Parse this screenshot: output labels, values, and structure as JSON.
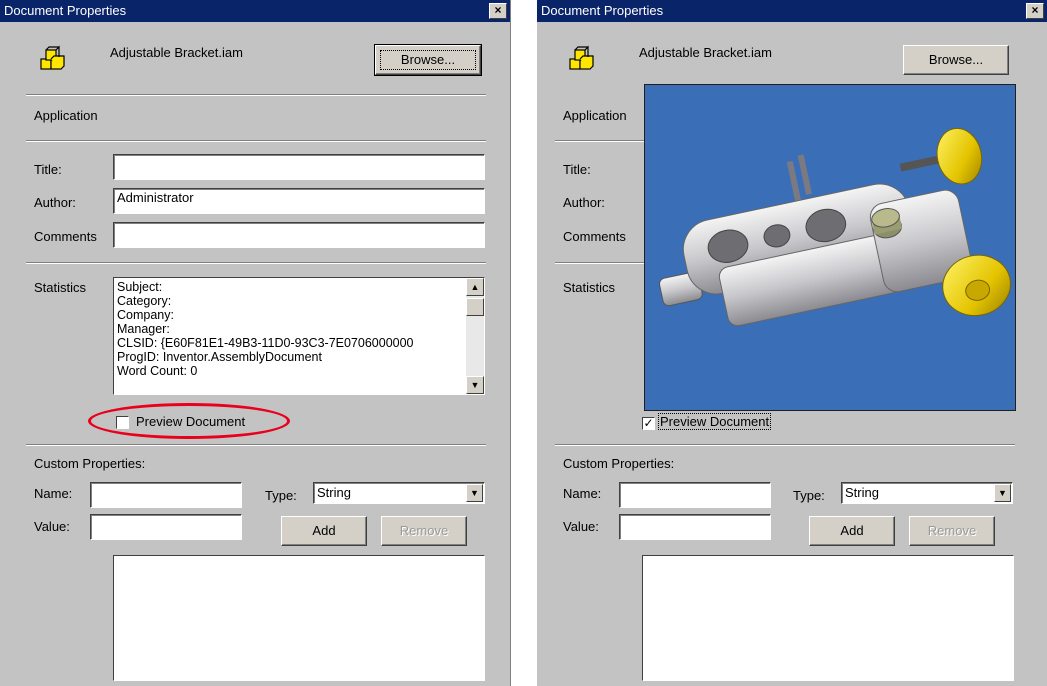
{
  "left_dialog": {
    "title": "Document Properties",
    "close_glyph": "×",
    "filename": "Adjustable Bracket.iam",
    "browse_label": "Browse...",
    "application_label": "Application",
    "title_label": "Title:",
    "title_value": "",
    "author_label": "Author:",
    "author_value": "Administrator",
    "comments_label": "Comments",
    "comments_value": "",
    "statistics_label": "Statistics",
    "statistics_lines": [
      "Subject:",
      "Category:",
      "Company:",
      "Manager:",
      "CLSID: {E60F81E1-49B3-11D0-93C3-7E0706000000",
      "ProgID: Inventor.AssemblyDocument",
      "Word Count: 0"
    ],
    "preview_label": "Preview Document",
    "preview_checked": false,
    "custom_properties_label": "Custom Properties:",
    "name_label": "Name:",
    "name_value": "",
    "value_label": "Value:",
    "value_value": "",
    "type_label": "Type:",
    "type_value": "String",
    "add_label": "Add",
    "remove_label": "Remove",
    "highlight_color": "#e8001c"
  },
  "right_dialog": {
    "title": "Document Properties",
    "close_glyph": "×",
    "filename": "Adjustable Bracket.iam",
    "browse_label": "Browse...",
    "application_label": "Application",
    "title_label": "Title:",
    "author_label": "Author:",
    "comments_label": "Comments",
    "statistics_label": "Statistics",
    "preview_label": "Preview Document",
    "preview_checked": true,
    "check_glyph": "✓",
    "custom_properties_label": "Custom Properties:",
    "name_label": "Name:",
    "name_value": "",
    "value_label": "Value:",
    "value_value": "",
    "type_label": "Type:",
    "type_value": "String",
    "add_label": "Add",
    "remove_label": "Remove",
    "preview_background": "#3a6fb8"
  },
  "icons": {
    "assembly": "assembly-icon",
    "scroll_up": "▲",
    "scroll_down": "▼",
    "combo_down": "▼"
  }
}
